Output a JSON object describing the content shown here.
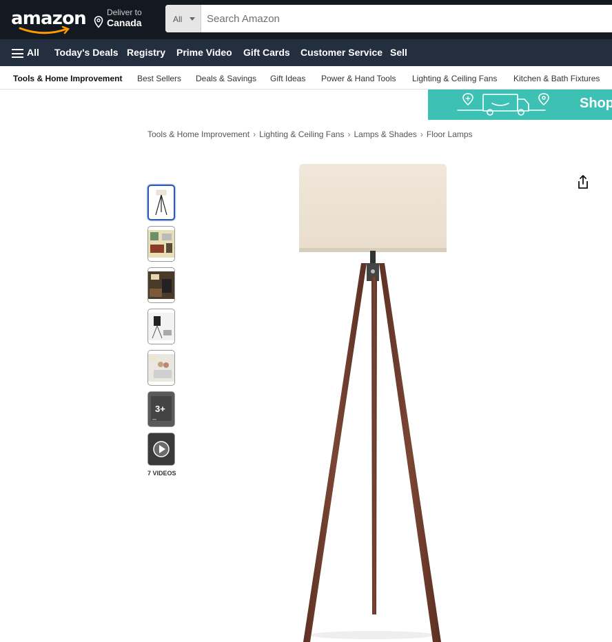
{
  "header": {
    "logo": "amazon",
    "deliver_line1": "Deliver to",
    "deliver_line2": "Canada",
    "search_department": "All",
    "search_placeholder": "Search Amazon"
  },
  "nav": {
    "all_label": "All",
    "items": [
      "Today's Deals",
      "Registry",
      "Prime Video",
      "Gift Cards",
      "Customer Service",
      "Sell"
    ]
  },
  "subnav": {
    "items": [
      "Tools & Home Improvement",
      "Best Sellers",
      "Deals & Savings",
      "Gift Ideas",
      "Power & Hand Tools",
      "Lighting & Ceiling Fans",
      "Kitchen & Bath Fixtures"
    ]
  },
  "banner": {
    "text": "Shop"
  },
  "breadcrumb": [
    "Tools & Home Improvement",
    "Lighting & Ceiling Fans",
    "Lamps & Shades",
    "Floor Lamps"
  ],
  "gallery": {
    "more_images": "3+",
    "videos_label": "7 VIDEOS"
  },
  "colors": {
    "header_bg": "#131921",
    "nav_bg": "#232f3e",
    "banner_bg": "#3cc1b4",
    "logo_smile": "#ff9900",
    "thumb_selected": "#2e5aac"
  }
}
